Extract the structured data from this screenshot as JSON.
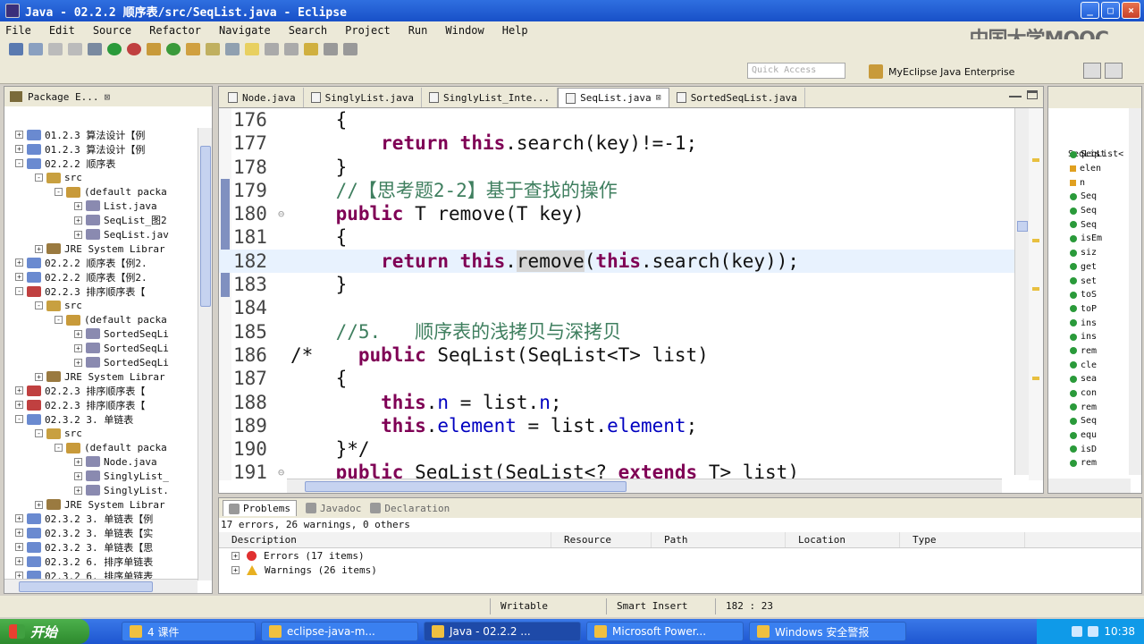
{
  "window": {
    "title": "Java - 02.2.2  顺序表/src/SeqList.java - Eclipse"
  },
  "watermark": "中国大学MOOC",
  "menu": [
    "File",
    "Edit",
    "Source",
    "Refactor",
    "Navigate",
    "Search",
    "Project",
    "Run",
    "Window",
    "Help"
  ],
  "quick_access": {
    "placeholder": "Quick Access"
  },
  "perspective": {
    "label": "MyEclipse Java Enterprise"
  },
  "package_explorer": {
    "title": "Package E...",
    "items": [
      {
        "exp": "+",
        "label": "01.2.3  算法设计【例",
        "indent": 0,
        "icon": "project"
      },
      {
        "exp": "+",
        "label": "01.2.3  算法设计【例",
        "indent": 0,
        "icon": "project"
      },
      {
        "exp": "-",
        "label": "02.2.2  顺序表",
        "indent": 0,
        "icon": "project"
      },
      {
        "exp": "-",
        "label": "src",
        "indent": 1,
        "icon": "folder"
      },
      {
        "exp": "-",
        "label": "(default packa",
        "indent": 2,
        "icon": "package"
      },
      {
        "exp": "+",
        "label": "List.java",
        "indent": 3,
        "icon": "java"
      },
      {
        "exp": "+",
        "label": "SeqList_图2",
        "indent": 3,
        "icon": "java"
      },
      {
        "exp": "+",
        "label": "SeqList.jav",
        "indent": 3,
        "icon": "java"
      },
      {
        "exp": "+",
        "label": "JRE System Librar",
        "indent": 1,
        "icon": "library"
      },
      {
        "exp": "+",
        "label": "02.2.2  顺序表【例2.",
        "indent": 0,
        "icon": "project"
      },
      {
        "exp": "+",
        "label": "02.2.2  顺序表【例2.",
        "indent": 0,
        "icon": "project"
      },
      {
        "exp": "-",
        "label": "02.2.3  排序顺序表【",
        "indent": 0,
        "icon": "project-err"
      },
      {
        "exp": "-",
        "label": "src",
        "indent": 1,
        "icon": "folder"
      },
      {
        "exp": "-",
        "label": "(default packa",
        "indent": 2,
        "icon": "package"
      },
      {
        "exp": "+",
        "label": "SortedSeqLi",
        "indent": 3,
        "icon": "java"
      },
      {
        "exp": "+",
        "label": "SortedSeqLi",
        "indent": 3,
        "icon": "java"
      },
      {
        "exp": "+",
        "label": "SortedSeqLi",
        "indent": 3,
        "icon": "java"
      },
      {
        "exp": "+",
        "label": "JRE System Librar",
        "indent": 1,
        "icon": "library"
      },
      {
        "exp": "+",
        "label": "02.2.3  排序顺序表【",
        "indent": 0,
        "icon": "project-err"
      },
      {
        "exp": "+",
        "label": "02.2.3  排序顺序表【",
        "indent": 0,
        "icon": "project-err"
      },
      {
        "exp": "-",
        "label": "02.3.2  3. 单链表",
        "indent": 0,
        "icon": "project"
      },
      {
        "exp": "-",
        "label": "src",
        "indent": 1,
        "icon": "folder"
      },
      {
        "exp": "-",
        "label": "(default packa",
        "indent": 2,
        "icon": "package"
      },
      {
        "exp": "+",
        "label": "Node.java",
        "indent": 3,
        "icon": "java"
      },
      {
        "exp": "+",
        "label": "SinglyList_",
        "indent": 3,
        "icon": "java"
      },
      {
        "exp": "+",
        "label": "SinglyList.",
        "indent": 3,
        "icon": "java"
      },
      {
        "exp": "+",
        "label": "JRE System Librar",
        "indent": 1,
        "icon": "library"
      },
      {
        "exp": "+",
        "label": "02.3.2  3. 单链表【例",
        "indent": 0,
        "icon": "project"
      },
      {
        "exp": "+",
        "label": "02.3.2  3. 单链表【实",
        "indent": 0,
        "icon": "project"
      },
      {
        "exp": "+",
        "label": "02.3.2  3. 单链表【思",
        "indent": 0,
        "icon": "project"
      },
      {
        "exp": "+",
        "label": "02.3.2  6. 排序单链表",
        "indent": 0,
        "icon": "project"
      },
      {
        "exp": "+",
        "label": "02.3.2  6. 排序单链表",
        "indent": 0,
        "icon": "project"
      }
    ]
  },
  "editor": {
    "tabs": [
      {
        "label": "Node.java",
        "active": false
      },
      {
        "label": "SinglyList.java",
        "active": false
      },
      {
        "label": "SinglyList_Inte...",
        "active": false
      },
      {
        "label": "SeqList.java",
        "active": true
      },
      {
        "label": "SortedSeqList.java",
        "active": false
      }
    ],
    "lines": [
      {
        "num": "176",
        "fold": "",
        "code": "    {"
      },
      {
        "num": "177",
        "fold": "",
        "code": "        return this.search(key)!=-1;"
      },
      {
        "num": "178",
        "fold": "",
        "code": "    }"
      },
      {
        "num": "179",
        "fold": "",
        "code": "    //【思考题2-2】基于查找的操作"
      },
      {
        "num": "180",
        "fold": "⊖",
        "code": "    public T remove(T key)"
      },
      {
        "num": "181",
        "fold": "",
        "code": "    {"
      },
      {
        "num": "182",
        "fold": "",
        "code": "        return this.remove(this.search(key));"
      },
      {
        "num": "183",
        "fold": "",
        "code": "    }"
      },
      {
        "num": "184",
        "fold": "",
        "code": ""
      },
      {
        "num": "185",
        "fold": "",
        "code": "    //5.   顺序表的浅拷贝与深拷贝"
      },
      {
        "num": "186",
        "fold": "",
        "code": "/*    public SeqList(SeqList<T> list)"
      },
      {
        "num": "187",
        "fold": "",
        "code": "    {"
      },
      {
        "num": "188",
        "fold": "",
        "code": "        this.n = list.n;"
      },
      {
        "num": "189",
        "fold": "",
        "code": "        this.element = list.element;"
      },
      {
        "num": "190",
        "fold": "",
        "code": "    }*/"
      },
      {
        "num": "191",
        "fold": "⊖",
        "code": "    public SeqList(SeqList<? extends T> list)"
      }
    ]
  },
  "outline": {
    "title": "SeqList",
    "items": [
      "SeqList<",
      "elen",
      "n",
      "Seq",
      "Seq",
      "Seq",
      "isEm",
      "siz",
      "get",
      "set",
      "toS",
      "toP",
      "ins",
      "ins",
      "rem",
      "cle",
      "sea",
      "con",
      "rem",
      "Seq",
      "equ",
      "isD",
      "rem"
    ]
  },
  "problems": {
    "tabs": [
      "Problems",
      "Javadoc",
      "Declaration"
    ],
    "summary": "17 errors, 26 warnings, 0 others",
    "columns": [
      "Description",
      "Resource",
      "Path",
      "Location",
      "Type"
    ],
    "rows": [
      "Errors (17 items)",
      "Warnings (26 items)"
    ]
  },
  "status": {
    "writable": "Writable",
    "insert_mode": "Smart Insert",
    "position": "182 : 23"
  },
  "taskbar": {
    "start": "开始",
    "tasks": [
      "4 课件",
      "eclipse-java-m...",
      "Java - 02.2.2 ...",
      "Microsoft Power...",
      "Windows 安全警报"
    ],
    "clock": "10:38"
  }
}
